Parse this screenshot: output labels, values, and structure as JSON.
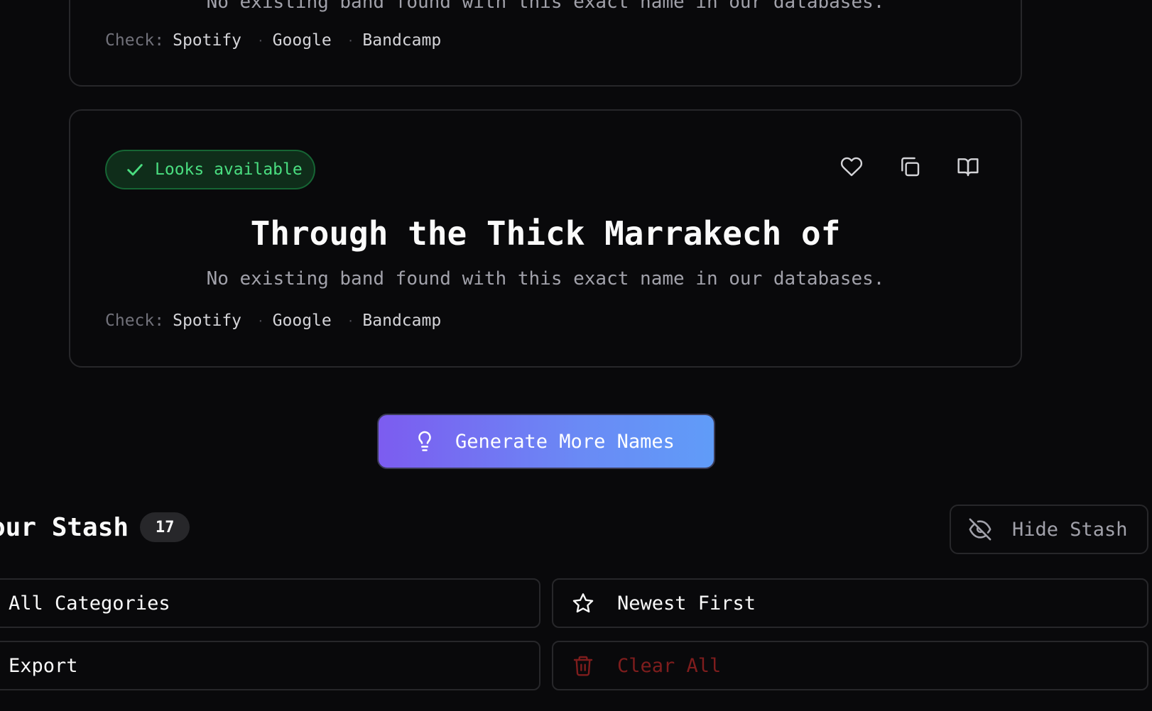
{
  "cards": [
    {
      "description": "No existing band found with this exact name in our databases.",
      "check_label": "Check:",
      "check_links": [
        "Spotify",
        "Google",
        "Bandcamp"
      ]
    },
    {
      "badge": "Looks available",
      "title": "Through the Thick Marrakech of",
      "description": "No existing band found with this exact name in our databases.",
      "check_label": "Check:",
      "check_links": [
        "Spotify",
        "Google",
        "Bandcamp"
      ],
      "actions": [
        "heart-icon",
        "copy-icon",
        "book-open-icon"
      ]
    }
  ],
  "generate": {
    "label": "Generate More Names",
    "icon": "lightbulb-icon"
  },
  "stash": {
    "title": "our Stash",
    "count": "17",
    "hide_label": "Hide Stash",
    "hide_icon": "eye-off-icon",
    "category_filter": "All Categories",
    "sort": {
      "label": "Newest First",
      "icon": "star-icon"
    },
    "export_label": "Export",
    "clear": {
      "label": "Clear All",
      "icon": "trash-icon"
    }
  },
  "colors": {
    "background": "#09090b",
    "border": "#27272a",
    "success": "#4ade80",
    "danger": "#7f1d1d",
    "gradient_start": "#7c5cf0",
    "gradient_end": "#609cf8"
  }
}
